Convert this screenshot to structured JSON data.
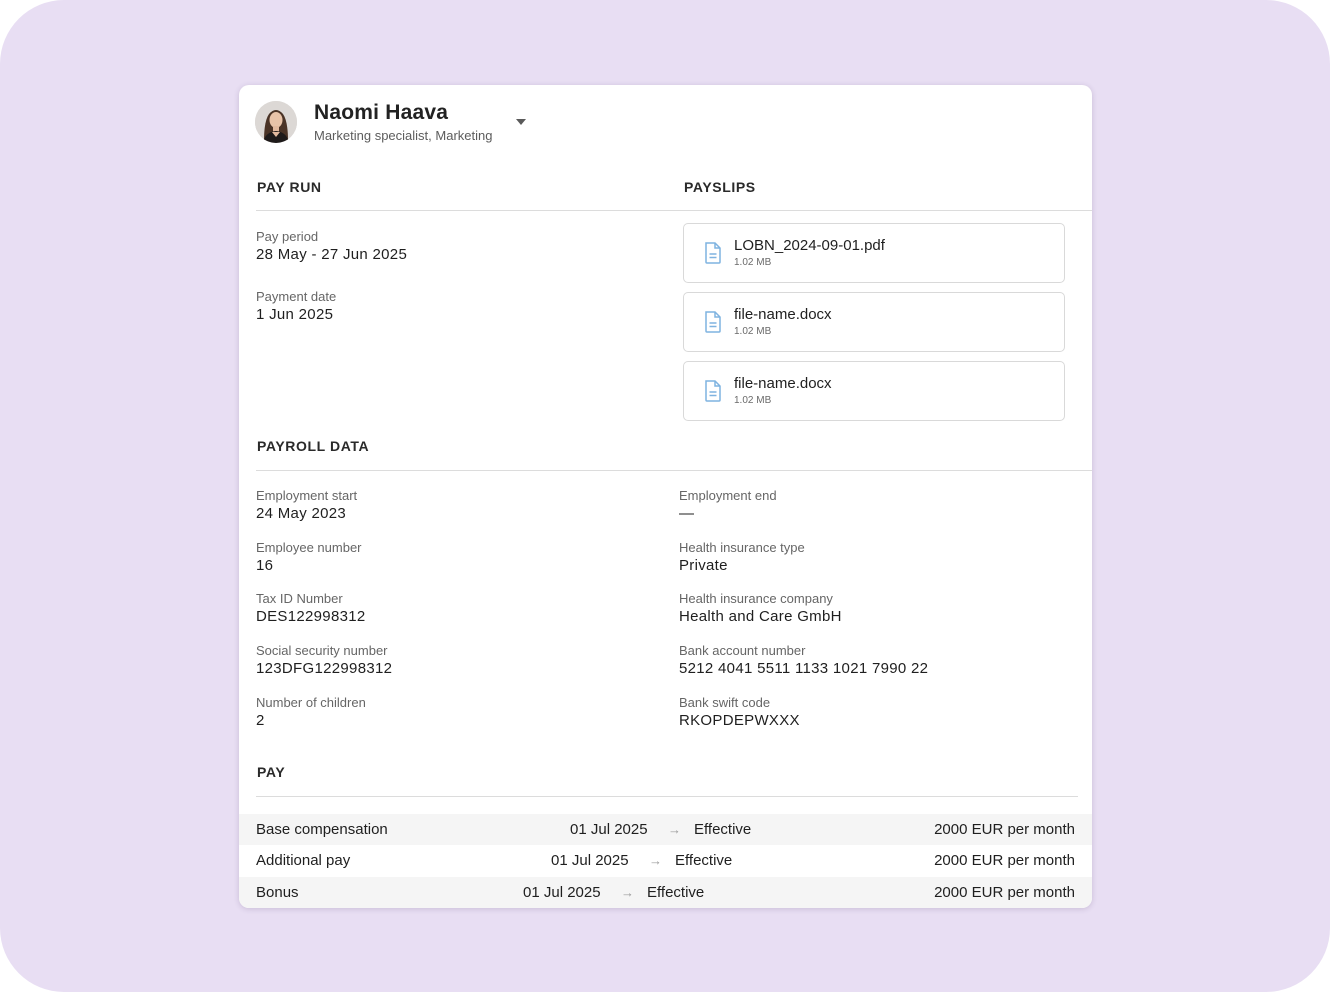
{
  "employee": {
    "name": "Naomi Haava",
    "role": "Marketing specialist, Marketing"
  },
  "pay_run": {
    "title": "PAY RUN",
    "pay_period_label": "Pay period",
    "pay_period_value": "28 May - 27 Jun 2025",
    "payment_date_label": "Payment date",
    "payment_date_value": "1 Jun 2025"
  },
  "payslips": {
    "title": "PAYSLIPS",
    "files": [
      {
        "name": "LOBN_2024-09-01.pdf",
        "size": "1.02 MB",
        "icon": "document-icon"
      },
      {
        "name": "file-name.docx",
        "size": "1.02 MB",
        "icon": "document-icon"
      },
      {
        "name": "file-name.docx",
        "size": "1.02 MB",
        "icon": "document-icon"
      }
    ]
  },
  "payroll_data": {
    "title": "PAYROLL DATA",
    "left": [
      {
        "label": "Employment start",
        "value": "24 May 2023"
      },
      {
        "label": "Employee number",
        "value": "16"
      },
      {
        "label": "Tax ID Number",
        "value": "DES122998312"
      },
      {
        "label": "Social security number",
        "value": "123DFG122998312"
      },
      {
        "label": "Number of children",
        "value": "2"
      }
    ],
    "right": [
      {
        "label": "Employment end",
        "value": "—"
      },
      {
        "label": "Health insurance type",
        "value": "Private"
      },
      {
        "label": "Health insurance company",
        "value": "Health and Care GmbH"
      },
      {
        "label": "Bank account number",
        "value": "5212 4041 5511 1133 1021 7990 22"
      },
      {
        "label": "Bank swift code",
        "value": "RKOPDEPWXXX"
      }
    ]
  },
  "pay": {
    "title": "PAY",
    "rows": [
      {
        "type": "Base compensation",
        "date": "01 Jul 2025",
        "arrow": "→",
        "status": "Effective",
        "amount": "2000 EUR per month"
      },
      {
        "type": "Additional pay",
        "date": "01 Jul 2025",
        "arrow": "→",
        "status": "Effective",
        "amount": "2000 EUR per month"
      },
      {
        "type": "Bonus",
        "date": "01 Jul 2025",
        "arrow": "→",
        "status": "Effective",
        "amount": "2000 EUR per month"
      }
    ]
  },
  "colors": {
    "background": "#e8def3",
    "card": "#ffffff",
    "file_icon": "#7fb3e0",
    "row_shade": "#f5f5f5"
  }
}
